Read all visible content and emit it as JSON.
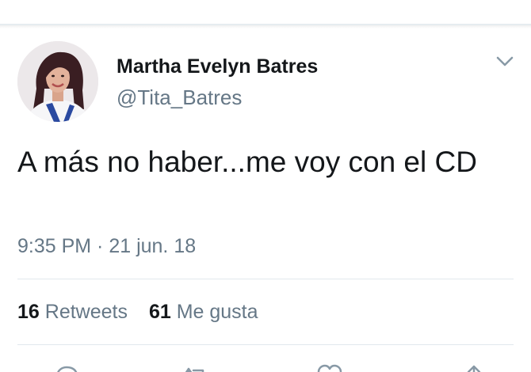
{
  "tweet": {
    "display_name": "Martha Evelyn Batres",
    "handle": "@Tita_Batres",
    "text": "A más no haber...me voy con el CD",
    "timestamp": "9:35 PM · 21 jun. 18"
  },
  "stats": {
    "retweets_count": "16",
    "retweets_label": "Retweets",
    "likes_count": "61",
    "likes_label": "Me gusta"
  },
  "icons": {
    "menu": "chevron-down-icon",
    "reply": "reply-icon",
    "retweet": "retweet-icon",
    "like": "heart-icon",
    "share": "share-icon"
  },
  "colors": {
    "text_primary": "#14171a",
    "text_secondary": "#657786",
    "divider": "#e1e8ed"
  }
}
